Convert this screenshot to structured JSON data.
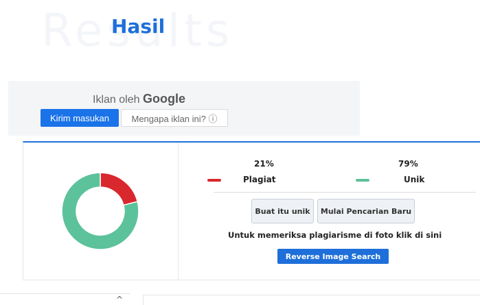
{
  "header": {
    "watermark": "Results",
    "title": "Hasil"
  },
  "ad": {
    "label_prefix": "Iklan oleh",
    "label_brand": "Google",
    "submit_label": "Kirim masukan",
    "why_label": "Mengapa iklan ini? ⓘ"
  },
  "result": {
    "plagiarism_percent": "21%",
    "plagiarism_label": "Plagiat",
    "unique_percent": "79%",
    "unique_label": "Unik",
    "make_unique_label": "Buat itu unik",
    "new_search_label": "Mulai Pencarian Baru",
    "image_hint": "Untuk memeriksa plagiarisme di foto klik di sini",
    "reverse_search_label": "Reverse Image Search"
  },
  "chart_data": {
    "type": "pie",
    "categories": [
      "Plagiat",
      "Unik"
    ],
    "values": [
      21,
      79
    ],
    "colors": [
      "#d9272e",
      "#5cc29b"
    ]
  },
  "footer": {
    "collapse_icon": "^"
  }
}
